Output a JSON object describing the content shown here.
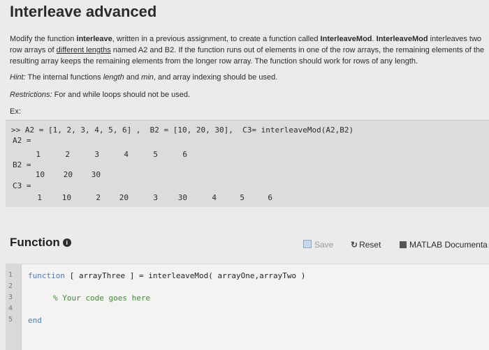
{
  "title": "Interleave advanced",
  "description": {
    "p1": "Modify the function ",
    "p2": "interleave",
    "p3": ", written in a previous assignment, to create a function called ",
    "p4": "InterleaveMod",
    "p5": ". ",
    "p6": "InterleaveMod",
    "p7": " interleaves two row arrays of ",
    "p8": "different lengths",
    "p9": " named A2 and B2. If the function runs out of elements in one of the row arrays, the remaining elements of the resulting array keeps the remaining elements from the longer row array. The function should work for rows of any length."
  },
  "hint": {
    "label": "Hint:",
    "t1": " The internal functions ",
    "fn1": "length",
    "t2": " and ",
    "fn2": "min",
    "t3": ", and array indexing should be used."
  },
  "restrictions": {
    "label": "Restrictions:",
    "text": " For and while loops should not be used."
  },
  "example_label": "Ex:",
  "example": {
    "command": ">> A2 = [1, 2, 3, 4, 5, 6] ,  B2 = [10, 20, 30],  C3= interleaveMod(A2,B2)",
    "a2_label": "A2 =",
    "a2_values": [
      "1",
      "2",
      "3",
      "4",
      "5",
      "6"
    ],
    "b2_label": "B2 =",
    "b2_values": [
      "10",
      "20",
      "30"
    ],
    "c3_label": "C3 =",
    "c3_values": [
      "1",
      "10",
      "2",
      "20",
      "3",
      "30",
      "4",
      "5",
      "6"
    ]
  },
  "function_section": {
    "heading": "Function",
    "save_label": "Save",
    "reset_label": "Reset",
    "docs_label": "MATLAB Documenta"
  },
  "editor": {
    "line_numbers": [
      "1",
      "2",
      "3",
      "4",
      "5"
    ],
    "line1_kw": "function",
    "line1_rest": " [ arrayThree ] = interleaveMod( arrayOne,arrayTwo )",
    "line3": "% Your code goes here",
    "line5": "end"
  }
}
